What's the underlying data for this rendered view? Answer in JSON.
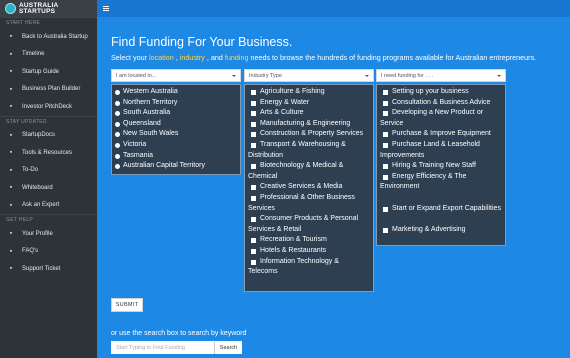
{
  "brand": {
    "line1": "AUSTRALIA",
    "line2": "STARTUPS"
  },
  "sidebar": {
    "section_home": "START HERE",
    "home_items": [
      {
        "label": "Back to Australia Startup",
        "icon": "back-arrow-icon"
      },
      {
        "label": "Timeline",
        "icon": "timeline-icon"
      },
      {
        "label": "Startup Guide",
        "icon": "guide-icon"
      },
      {
        "label": "Business Plan Builder",
        "icon": "document-icon"
      },
      {
        "label": "Investor PitchDeck",
        "icon": "presentation-icon"
      }
    ],
    "section_updated": "STAY UPDATED",
    "updated_items": [
      {
        "label": "StartupDocs",
        "icon": "docs-icon"
      },
      {
        "label": "Tools & Resources",
        "icon": "wrench-icon"
      },
      {
        "label": "To-Do",
        "icon": "checklist-icon"
      },
      {
        "label": "Whiteboard",
        "icon": "whiteboard-icon"
      },
      {
        "label": "Ask an Expert",
        "icon": "expert-icon"
      }
    ],
    "section_help": "GET HELP",
    "help_items": [
      {
        "label": "Your Profile",
        "icon": "user-icon"
      },
      {
        "label": "FAQ's",
        "icon": "question-icon"
      },
      {
        "label": "Support Ticket",
        "icon": "ticket-icon"
      }
    ]
  },
  "main": {
    "title": "Find Funding For Your Business.",
    "subtitle_prefix": "Select your ",
    "subtitle_location": "location",
    "subtitle_sep1": " , ",
    "subtitle_industry": "industry",
    "subtitle_sep2": " , and ",
    "subtitle_funding": "funding",
    "subtitle_suffix": " needs to browse the hundreds of funding programs available for Australian entrepreneurs.",
    "location_select": "I am located in...",
    "industry_select": "Industry Type",
    "funding_select": "I need funding for . . .",
    "locations": [
      "Western Australia",
      "Northern Territory",
      "South Australia",
      "Queensland",
      "New South Wales",
      "Victoria",
      "Tasmania",
      "Australian Capital Territory"
    ],
    "industries": [
      "Agriculture & Fishing",
      "Energy & Water",
      "Arts & Culture",
      "Manufacturing & Engineering",
      "Construction & Property Services",
      "Transport & Warehousing & Distribution",
      "Biotechnology & Medical & Chemical",
      "Creative Services & Media",
      "Professional & Other Business Services",
      "Consumer Products & Personal Services & Retail",
      "Recreation & Tourism",
      "Hotels & Restaurants",
      "Information Technology & Telecoms"
    ],
    "funding_needs": [
      "Setting up your business",
      "Consultation & Business Advice",
      "Developing a New Product or Service",
      "Purchase & Improve Equipment",
      "Purchase Land & Leasehold Improvements",
      "Hiring & Training New Staff",
      "Energy Efficiency & The Environment",
      "",
      "Start or Expand Export Capabilities",
      "",
      "Marketing & Advertising"
    ],
    "submit_label": "SUBMIT",
    "or_search_text": "or use the search box to search by keyword",
    "search_placeholder": "Start Typing to Find Funding",
    "search_button": "Search"
  },
  "colors": {
    "background": "#1e88e5",
    "sidebar": "#2e3338",
    "panel": "#2e3f52",
    "highlight": "#ffd54f"
  }
}
